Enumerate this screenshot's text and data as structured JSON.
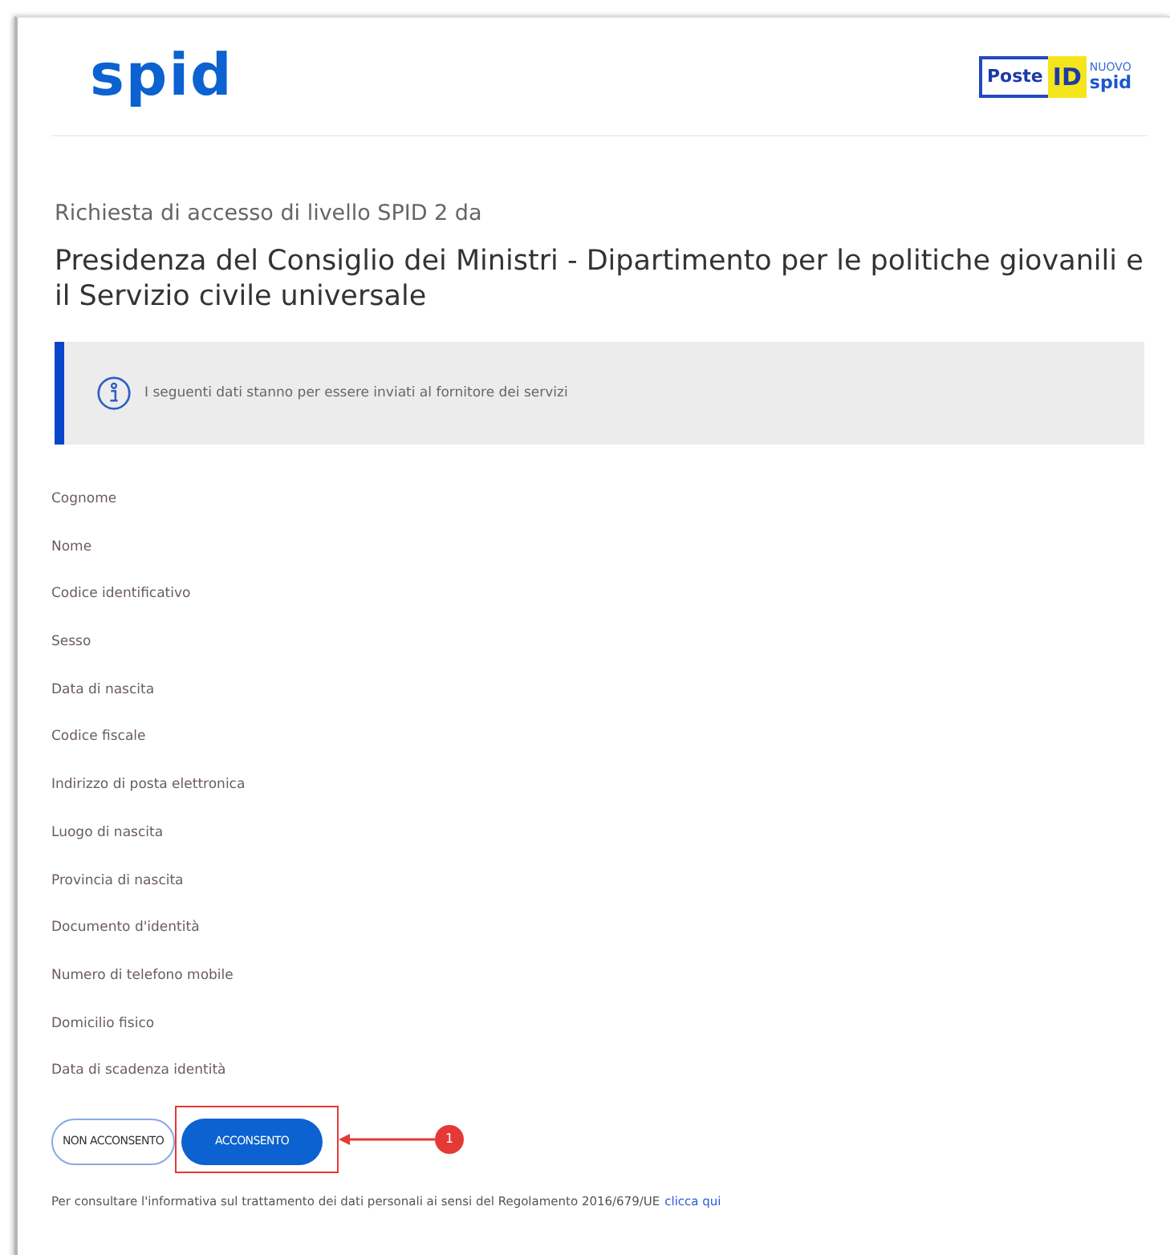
{
  "header": {
    "logo": "spid",
    "provider_logo": {
      "brand": "Poste",
      "id": "ID",
      "badge_top": "NUOVO",
      "badge_bottom": "spid"
    }
  },
  "request": {
    "intro": "Richiesta di accesso di livello SPID 2 da",
    "requester": "Presidenza del Consiglio dei Ministri - Dipartimento per le politiche giovanili e il Servizio civile universale"
  },
  "notice": {
    "text": "I seguenti dati stanno per essere inviati al fornitore dei servizi"
  },
  "attributes": [
    "Cognome",
    "Nome",
    "Codice identificativo",
    "Sesso",
    "Data di nascita",
    "Codice fiscale",
    "Indirizzo di posta elettronica",
    "Luogo di nascita",
    "Provincia di nascita",
    "Documento d'identità",
    "Numero di telefono mobile",
    "Domicilio fisico",
    "Data di scadenza identità"
  ],
  "buttons": [
    {
      "label": "NON ACCONSENTO",
      "kind": "outline",
      "highlighted": false
    },
    {
      "label": "ACCONSENTO",
      "kind": "primary",
      "highlighted": true
    }
  ],
  "callout": {
    "number": "1"
  },
  "footer": {
    "text": "Per consultare l'informativa sul trattamento dei dati personali ai sensi del Regolamento 2016/679/UE",
    "link": "clicca qui"
  }
}
